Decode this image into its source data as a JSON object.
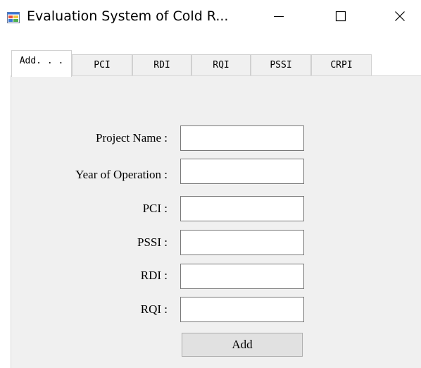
{
  "window": {
    "title": "Evaluation System of Cold R...",
    "minimize_icon": "minimize-icon",
    "maximize_icon": "maximize-icon",
    "close_icon": "close-icon",
    "app_icon": "window-app-icon"
  },
  "tabs": [
    {
      "label": "Add. . .",
      "active": true
    },
    {
      "label": "PCI",
      "active": false
    },
    {
      "label": "RDI",
      "active": false
    },
    {
      "label": "RQI",
      "active": false
    },
    {
      "label": "PSSI",
      "active": false
    },
    {
      "label": "CRPI",
      "active": false
    }
  ],
  "form": {
    "fields": [
      {
        "label": "Project Name :",
        "value": ""
      },
      {
        "label": "Year of Operation :",
        "value": ""
      },
      {
        "label": "PCI :",
        "value": ""
      },
      {
        "label": "PSSI :",
        "value": ""
      },
      {
        "label": "RDI :",
        "value": ""
      },
      {
        "label": "RQI :",
        "value": ""
      }
    ],
    "add_label": "Add"
  },
  "colors": {
    "panel_bg": "#f0f0f0",
    "button_bg": "#e1e1e1",
    "input_border": "#7a7a7a"
  }
}
